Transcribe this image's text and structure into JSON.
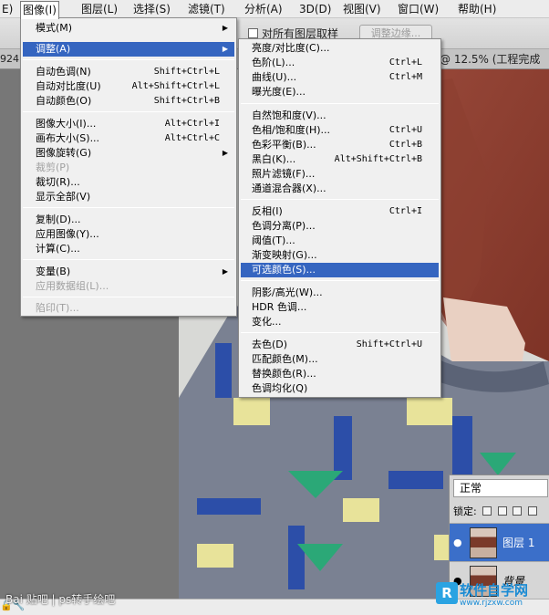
{
  "menubar": {
    "items": [
      {
        "label": "E)"
      },
      {
        "label": "图像(I)"
      },
      {
        "label": "图层(L)"
      },
      {
        "label": "选择(S)"
      },
      {
        "label": "滤镜(T)"
      },
      {
        "label": "分析(A)"
      },
      {
        "label": "3D(D)"
      },
      {
        "label": "视图(V)"
      },
      {
        "label": "窗口(W)"
      },
      {
        "label": "帮助(H)"
      }
    ]
  },
  "options_bar": {
    "sample_all_layers": "对所有图层取样",
    "refine_edge": "调整边缘..."
  },
  "doc_tab": {
    "left_text": "924",
    "right_text": "@ 12.5% (工程完成"
  },
  "image_menu": {
    "items": [
      {
        "label": "模式(M)",
        "shortcut": "",
        "submenu": true
      },
      {
        "label": "调整(A)",
        "shortcut": "",
        "submenu": true
      },
      {
        "label": "自动色调(N)",
        "shortcut": "Shift+Ctrl+L"
      },
      {
        "label": "自动对比度(U)",
        "shortcut": "Alt+Shift+Ctrl+L"
      },
      {
        "label": "自动颜色(O)",
        "shortcut": "Shift+Ctrl+B"
      },
      {
        "label": "图像大小(I)...",
        "shortcut": "Alt+Ctrl+I"
      },
      {
        "label": "画布大小(S)...",
        "shortcut": "Alt+Ctrl+C"
      },
      {
        "label": "图像旋转(G)",
        "shortcut": "",
        "submenu": true
      },
      {
        "label": "裁剪(P)",
        "shortcut": ""
      },
      {
        "label": "裁切(R)...",
        "shortcut": ""
      },
      {
        "label": "显示全部(V)",
        "shortcut": ""
      },
      {
        "label": "复制(D)...",
        "shortcut": ""
      },
      {
        "label": "应用图像(Y)...",
        "shortcut": ""
      },
      {
        "label": "计算(C)...",
        "shortcut": ""
      },
      {
        "label": "变量(B)",
        "shortcut": "",
        "submenu": true
      },
      {
        "label": "应用数据组(L)...",
        "shortcut": ""
      },
      {
        "label": "陷印(T)...",
        "shortcut": ""
      }
    ]
  },
  "adjust_menu": {
    "items": [
      {
        "label": "亮度/对比度(C)...",
        "shortcut": ""
      },
      {
        "label": "色阶(L)...",
        "shortcut": "Ctrl+L"
      },
      {
        "label": "曲线(U)...",
        "shortcut": "Ctrl+M"
      },
      {
        "label": "曝光度(E)...",
        "shortcut": ""
      },
      {
        "label": "自然饱和度(V)...",
        "shortcut": ""
      },
      {
        "label": "色相/饱和度(H)...",
        "shortcut": "Ctrl+U"
      },
      {
        "label": "色彩平衡(B)...",
        "shortcut": "Ctrl+B"
      },
      {
        "label": "黑白(K)...",
        "shortcut": "Alt+Shift+Ctrl+B"
      },
      {
        "label": "照片滤镜(F)...",
        "shortcut": ""
      },
      {
        "label": "通道混合器(X)...",
        "shortcut": ""
      },
      {
        "label": "反相(I)",
        "shortcut": "Ctrl+I"
      },
      {
        "label": "色调分离(P)...",
        "shortcut": ""
      },
      {
        "label": "阈值(T)...",
        "shortcut": ""
      },
      {
        "label": "渐变映射(G)...",
        "shortcut": ""
      },
      {
        "label": "可选颜色(S)...",
        "shortcut": ""
      },
      {
        "label": "阴影/高光(W)...",
        "shortcut": ""
      },
      {
        "label": "HDR 色调...",
        "shortcut": ""
      },
      {
        "label": "变化...",
        "shortcut": ""
      },
      {
        "label": "去色(D)",
        "shortcut": "Shift+Ctrl+U"
      },
      {
        "label": "匹配颜色(M)...",
        "shortcut": ""
      },
      {
        "label": "替换颜色(R)...",
        "shortcut": ""
      },
      {
        "label": "色调均化(Q)",
        "shortcut": ""
      }
    ]
  },
  "layers_panel": {
    "blend_mode": "正常",
    "lock_label": "锁定:",
    "layers": [
      {
        "name": "图层 1"
      },
      {
        "name": "背景"
      }
    ]
  },
  "watermark": {
    "left": "Bai 贴吧 | ps转手绘吧",
    "right_name": "软件自学网",
    "right_logo": "R",
    "right_url": "www.rjzxw.com"
  },
  "colors": {
    "menu_highlight": "#3565c0",
    "layer_selected": "#3b6fc9"
  }
}
